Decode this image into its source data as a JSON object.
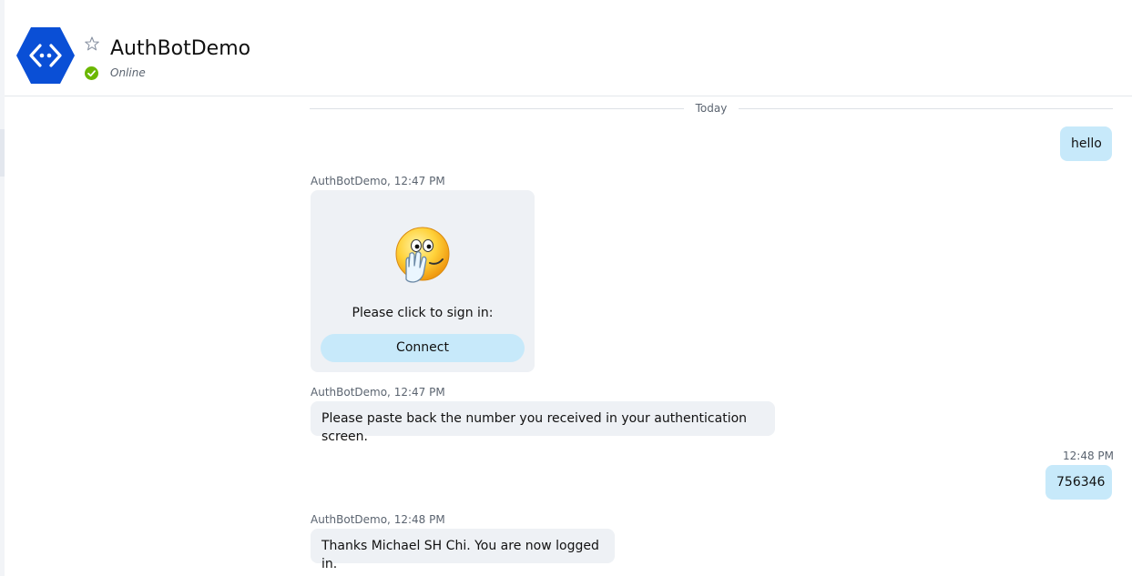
{
  "header": {
    "title": "AuthBotDemo",
    "status": "Online",
    "avatar_icon": "bot-avatar-icon",
    "favorite_icon": "star-outline-icon",
    "status_icon": "online-check-icon"
  },
  "colors": {
    "avatar_blue": "#0a4fd6",
    "outgoing_bubble": "#c7e9fa",
    "incoming_bubble": "#eef1f5",
    "online_green": "#6bb700"
  },
  "chat": {
    "day_divider": "Today",
    "msg1": {
      "text": "hello"
    },
    "msg2": {
      "meta": "AuthBotDemo, 12:47 PM",
      "card_prompt": "Please click to sign in:",
      "card_button": "Connect",
      "card_icon": "covering-mouth-emoji-icon"
    },
    "msg3": {
      "meta": "AuthBotDemo, 12:47 PM",
      "text": "Please paste back the number you received in your authentication screen."
    },
    "msg4": {
      "meta": "12:48 PM",
      "text": "756346"
    },
    "msg5": {
      "meta": "AuthBotDemo, 12:48 PM",
      "text": "Thanks Michael SH Chi. You are now logged in."
    }
  }
}
